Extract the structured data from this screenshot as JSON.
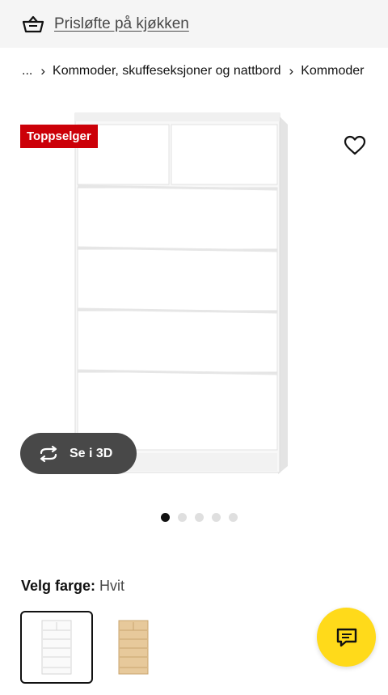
{
  "promo": {
    "icon": "basket-icon",
    "text": "Prisløfte på kjøkken"
  },
  "breadcrumb": {
    "ellipsis": "...",
    "separator": "›",
    "items": [
      "Kommoder, skuffeseksjoner og nattbord",
      "Kommoder"
    ]
  },
  "gallery": {
    "badge": "Toppselger",
    "badge_color": "#cc0008",
    "favorite_icon": "heart-icon",
    "see_3d_label": "Se i 3D",
    "see_3d_icon": "rotate-3d-icon",
    "image_count": 5,
    "active_image": 1
  },
  "color": {
    "label": "Velg farge:",
    "value": "Hvit",
    "options": [
      "Hvit",
      "Eikefiner"
    ],
    "selected": "Hvit"
  },
  "chat": {
    "icon": "chat-icon",
    "color": "#ffda1a"
  }
}
